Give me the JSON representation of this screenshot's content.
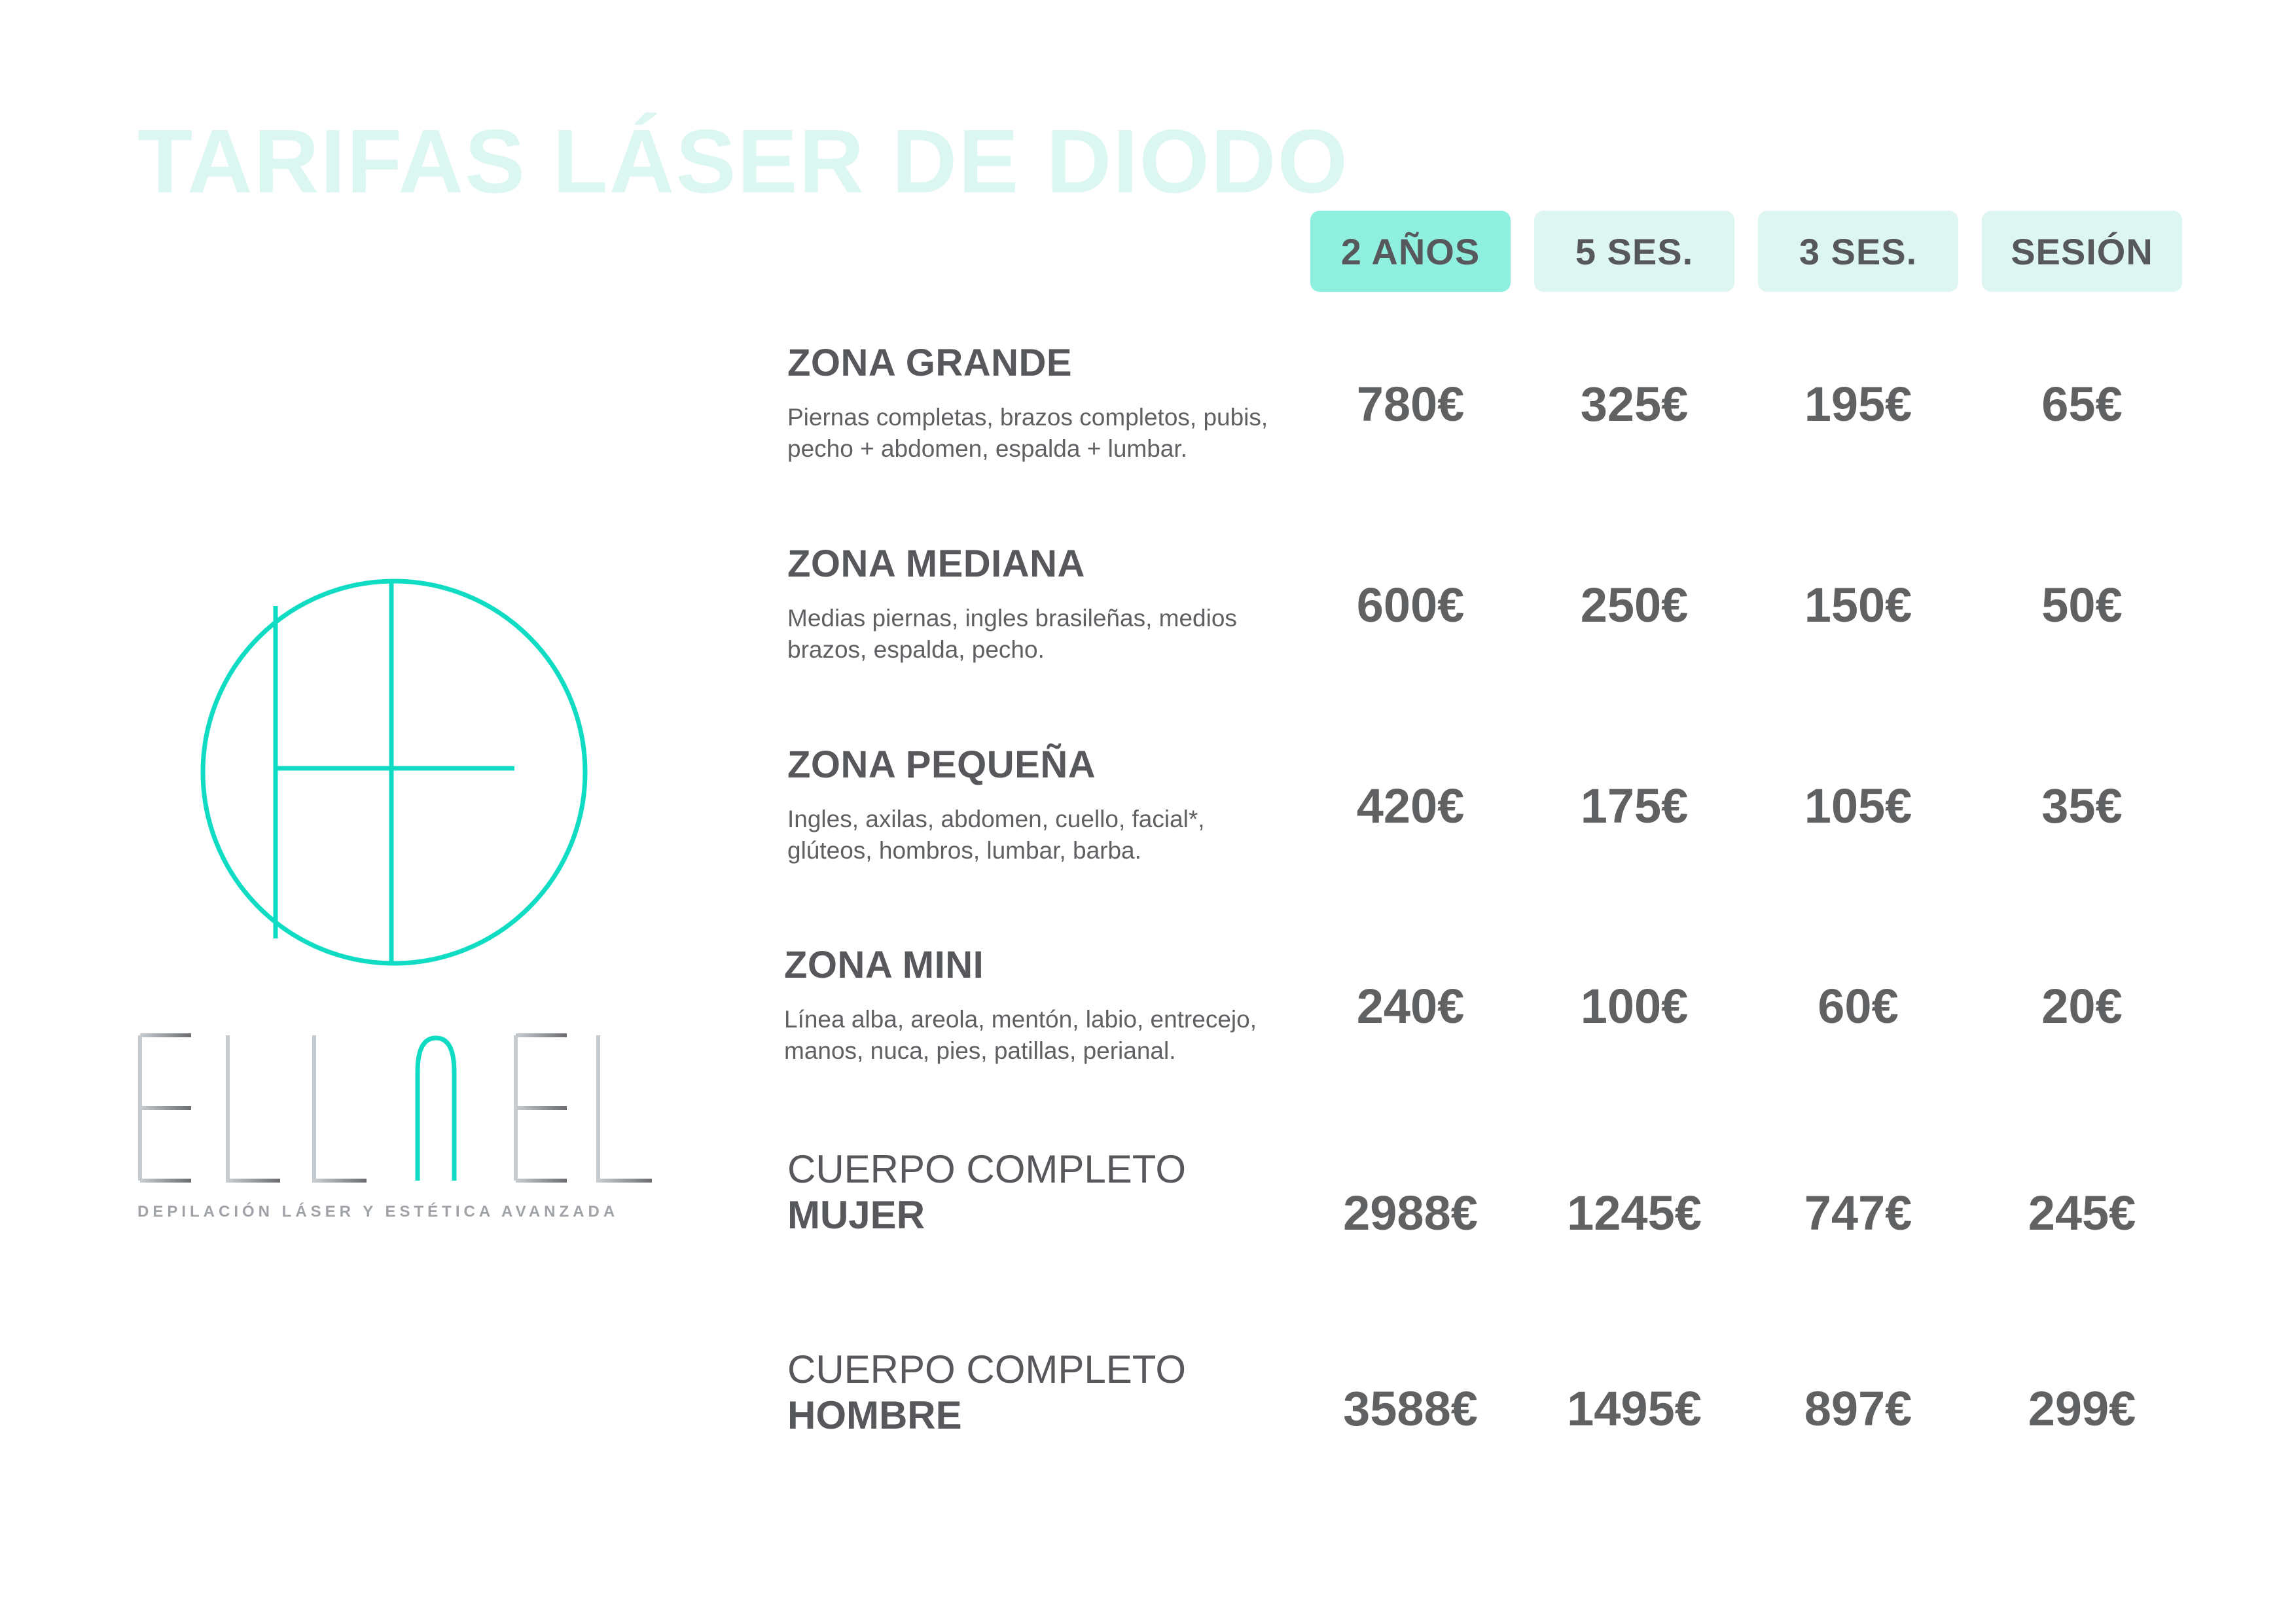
{
  "title": "TARIFAS LÁSER DE DIODO",
  "columns": [
    "2 AÑOS",
    "5 SES.",
    "3 SES.",
    "SESIÓN"
  ],
  "active_column": 0,
  "zones": [
    {
      "title": "ZONA GRANDE",
      "description_line1": "Piernas completas, brazos completos, pubis,",
      "description_line2": "pecho + abdomen, espalda + lumbar.",
      "prices": [
        "780€",
        "325€",
        "195€",
        "65€"
      ]
    },
    {
      "title": "ZONA MEDIANA",
      "description_line1": "Medias piernas, ingles brasileñas, medios",
      "description_line2": "brazos, espalda, pecho.",
      "prices": [
        "600€",
        "250€",
        "150€",
        "50€"
      ]
    },
    {
      "title": "ZONA PEQUEÑA",
      "description_line1": "Ingles, axilas, abdomen, cuello, facial*,",
      "description_line2": "glúteos, hombros, lumbar, barba.",
      "prices": [
        "420€",
        "175€",
        "105€",
        "35€"
      ]
    },
    {
      "title": "ZONA MINI",
      "description_line1": "Línea alba, areola, mentón, labio, entrecejo,",
      "description_line2": "manos, nuca, pies, patillas, perianal.",
      "prices": [
        "240€",
        "100€",
        "60€",
        "20€"
      ]
    }
  ],
  "full_body": [
    {
      "line1": "CUERPO COMPLETO",
      "line2": "MUJER",
      "prices": [
        "2988€",
        "1245€",
        "747€",
        "245€"
      ]
    },
    {
      "line1": "CUERPO COMPLETO",
      "line2": "HOMBRE",
      "prices": [
        "3588€",
        "1495€",
        "897€",
        "299€"
      ]
    }
  ],
  "brand": {
    "name": "ELLAEL",
    "tagline": "DEPILACIÓN LÁSER Y ESTÉTICA AVANZADA",
    "accent_color": "#10dcc4",
    "wordmark_gradient": [
      "#c7ccd0",
      "#6a6c6f"
    ]
  },
  "colors": {
    "title": "#dcf7f1",
    "header_pill": "#def6f2",
    "header_pill_active": "#8ff0e0",
    "text": "#5c5d5f"
  }
}
